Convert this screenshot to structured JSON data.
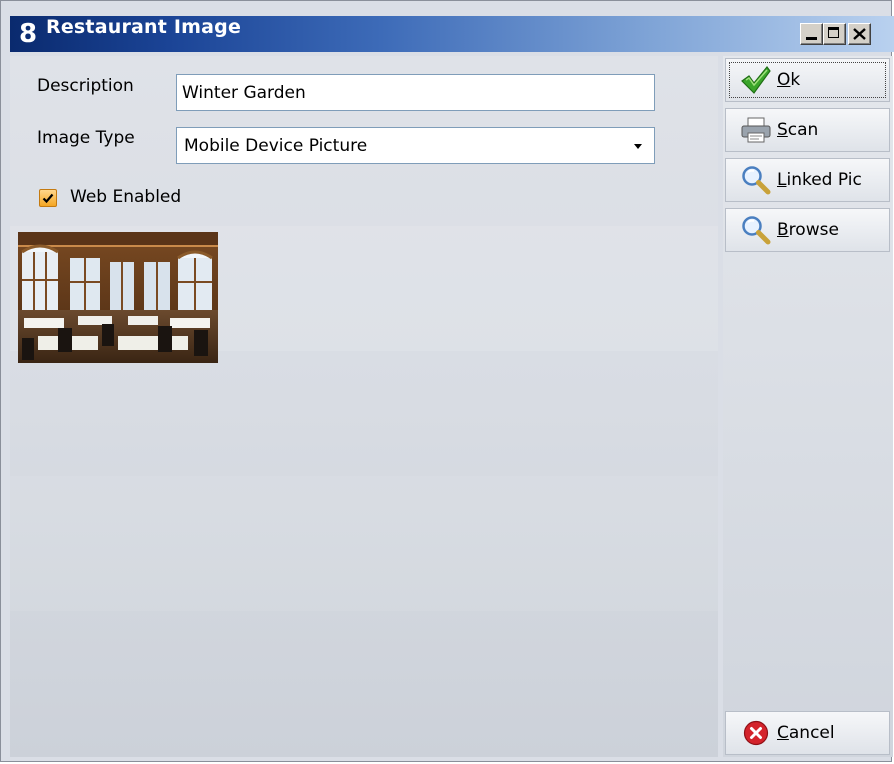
{
  "window": {
    "title": "Restaurant Image",
    "logo_text": "8"
  },
  "form": {
    "description_label": "Description",
    "description_value": "Winter Garden",
    "image_type_label": "Image Type",
    "image_type_value": "Mobile Device Picture",
    "web_enabled_label": "Web Enabled",
    "web_enabled": true
  },
  "buttons": {
    "ok": {
      "first": "O",
      "rest": "k"
    },
    "scan": {
      "first": "S",
      "rest": "can"
    },
    "linked": {
      "first": "L",
      "rest": "inked Pic"
    },
    "browse": {
      "first": "B",
      "rest": "rowse"
    },
    "cancel": {
      "first": "C",
      "rest": "ancel"
    }
  },
  "colors": {
    "title_dark": "#0a2a6e",
    "title_light": "#b9d1ef",
    "checkbox": "#f5a623",
    "ok_green": "#3aa52a",
    "cancel_red": "#d4232b"
  },
  "icons": [
    "app-logo-icon",
    "minimize-icon",
    "maximize-icon",
    "close-icon",
    "checkmark-icon",
    "printer-icon",
    "magnifier-icon",
    "cancel-icon"
  ]
}
